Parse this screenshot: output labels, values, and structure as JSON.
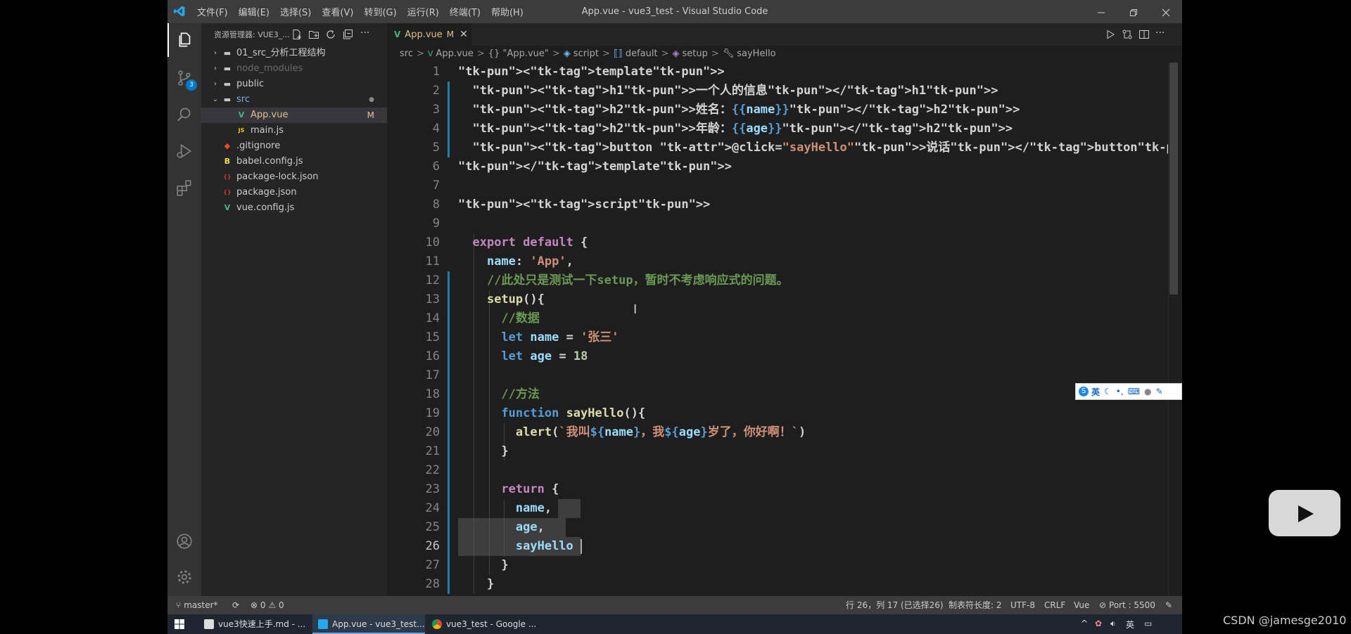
{
  "titlebar": {
    "menus": [
      "文件(F)",
      "编辑(E)",
      "选择(S)",
      "查看(V)",
      "转到(G)",
      "运行(R)",
      "终端(T)",
      "帮助(H)"
    ],
    "title": "App.vue - vue3_test - Visual Studio Code"
  },
  "activitybar": {
    "scm_badge": "3"
  },
  "sidebar": {
    "header": "资源管理器: VUE3_...",
    "items": [
      {
        "label": "01_src_分析工程结构",
        "kind": "folder"
      },
      {
        "label": "node_modules",
        "kind": "folder"
      },
      {
        "label": "public",
        "kind": "folder"
      },
      {
        "label": "src",
        "kind": "folder-open"
      },
      {
        "label": "App.vue",
        "kind": "vue",
        "status": "M"
      },
      {
        "label": "main.js",
        "kind": "js"
      },
      {
        "label": ".gitignore",
        "kind": "git"
      },
      {
        "label": "babel.config.js",
        "kind": "babel"
      },
      {
        "label": "package-lock.json",
        "kind": "json"
      },
      {
        "label": "package.json",
        "kind": "json"
      },
      {
        "label": "vue.config.js",
        "kind": "vue"
      }
    ]
  },
  "editor": {
    "tab": {
      "label": "App.vue",
      "status": "M"
    },
    "breadcrumb": [
      "src",
      "App.vue",
      "{} \"App.vue\"",
      "script",
      "default",
      "setup",
      "sayHello"
    ],
    "lines": [
      "<template>",
      "  <h1>一个人的信息</h1>",
      "  <h2>姓名：{{name}}</h2>",
      "  <h2>年龄：{{age}}</h2>",
      "  <button @click=\"sayHello\">说话</button>",
      "</template>",
      "",
      "<script>",
      "",
      "  export default {",
      "    name: 'App',",
      "    //此处只是测试一下setup，暂时不考虑响应式的问题。",
      "    setup(){",
      "      //数据",
      "      let name = '张三'",
      "      let age = 18",
      "",
      "      //方法",
      "      function sayHello(){",
      "        alert(`我叫${name}，我${age}岁了，你好啊！`)",
      "      }",
      "",
      "      return {",
      "        name,",
      "        age,",
      "        sayHello",
      "      }",
      "    }"
    ],
    "current_line": 26
  },
  "ime": {
    "label": "英"
  },
  "statusbar": {
    "branch": "master*",
    "errors": "0",
    "warnings": "0",
    "position": "行 26，列 17 (已选择26)",
    "tabsize": "制表符长度: 2",
    "encoding": "UTF-8",
    "eol": "CRLF",
    "language": "Vue",
    "port": "Port : 5500"
  },
  "taskbar": {
    "tasks": [
      "vue3快速上手.md - ...",
      "App.vue - vue3_test...",
      "vue3_test - Google ..."
    ],
    "ime": "英"
  },
  "watermark": "CSDN @jamesge2010"
}
